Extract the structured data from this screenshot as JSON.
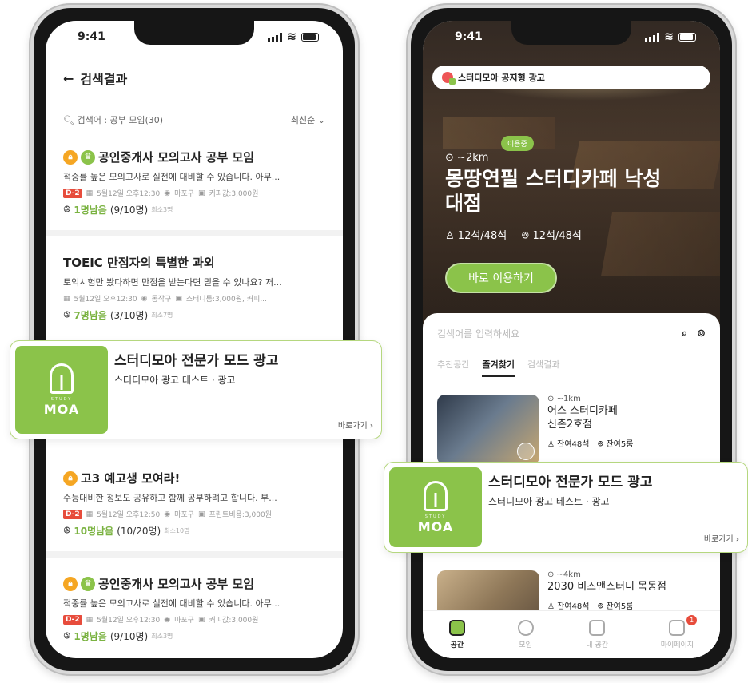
{
  "status": {
    "time": "9:41"
  },
  "left": {
    "header_title": "검색결과",
    "search_meta": "검색어 : 공부 모임(30)",
    "sort": "최신순",
    "posts": [
      {
        "title": "공인중개사 모의고사 공부 모임",
        "desc": "적중률 높은 모의고사로 실전에 대비할 수 있습니다. 아무...",
        "dday": "D-2",
        "date": "5월12일 오후12:30",
        "location": "마포구",
        "fee": "커피값:3,000원",
        "remain": "1명남음",
        "count": "(9/10명)",
        "min": "최소3명",
        "badges": [
          "o",
          "g"
        ]
      },
      {
        "title": "TOEIC 만점자의 특별한 과외",
        "desc": "토익시험만 봤다하면 만점을 받는다면 믿을 수 있나요? 저...",
        "dday": "",
        "date": "5월12일 오후12:30",
        "location": "동작구",
        "fee": "스터디룸:3,000원, 커피...",
        "remain": "7명남음",
        "count": "(3/10명)",
        "min": "최소7명",
        "badges": []
      },
      {
        "title": "고3 예고생 모여라!",
        "desc": "수능대비한 정보도 공유하고 함께 공부하려고 합니다. 부...",
        "dday": "D-2",
        "date": "5월12일 오후12:50",
        "location": "마포구",
        "fee": "프린트비용:3,000원",
        "remain": "10명남음",
        "count": "(10/20명)",
        "min": "최소10명",
        "badges": [
          "o"
        ]
      },
      {
        "title": "공인중개사 모의고사 공부 모임",
        "desc": "적중률 높은 모의고사로 실전에 대비할 수 있습니다. 아무...",
        "dday": "D-2",
        "date": "5월12일 오후12:30",
        "location": "마포구",
        "fee": "커피값:3,000원",
        "remain": "1명남음",
        "count": "(9/10명)",
        "min": "최소3명",
        "badges": [
          "o",
          "g"
        ]
      }
    ]
  },
  "ad": {
    "title": "스터디모아 전문가 모드 광고",
    "subtitle": "스터디모아 광고 테스트 · 광고",
    "go": "바로가기",
    "logo_small": "STUDY",
    "logo_big": "MOA"
  },
  "right": {
    "banner": "스터디모아 공지형 광고",
    "using": "이용중",
    "distance": "~2km",
    "cafe_name": "몽땅연필 스터디카페 낙성대점",
    "seat1": "12석/48석",
    "seat2": "12석/48석",
    "use_button": "바로 이용하기",
    "search_placeholder": "검색어를 입력하세요",
    "tabs": [
      "추천공간",
      "즐겨찾기",
      "검색결과"
    ],
    "spaces": [
      {
        "distance": "~1km",
        "name1": "어스 스터디카페",
        "name2": "신촌2호점",
        "seats": "잔여48석",
        "rooms": "잔여5룸"
      },
      {
        "distance": "~4km",
        "name1": "2030 비즈앤스터디 목동점",
        "name2": "",
        "seats": "잔여48석",
        "rooms": "잔여5룸"
      }
    ],
    "tabbar": [
      "공간",
      "모임",
      "내 공간",
      "마이페이지"
    ],
    "badge": "1"
  }
}
